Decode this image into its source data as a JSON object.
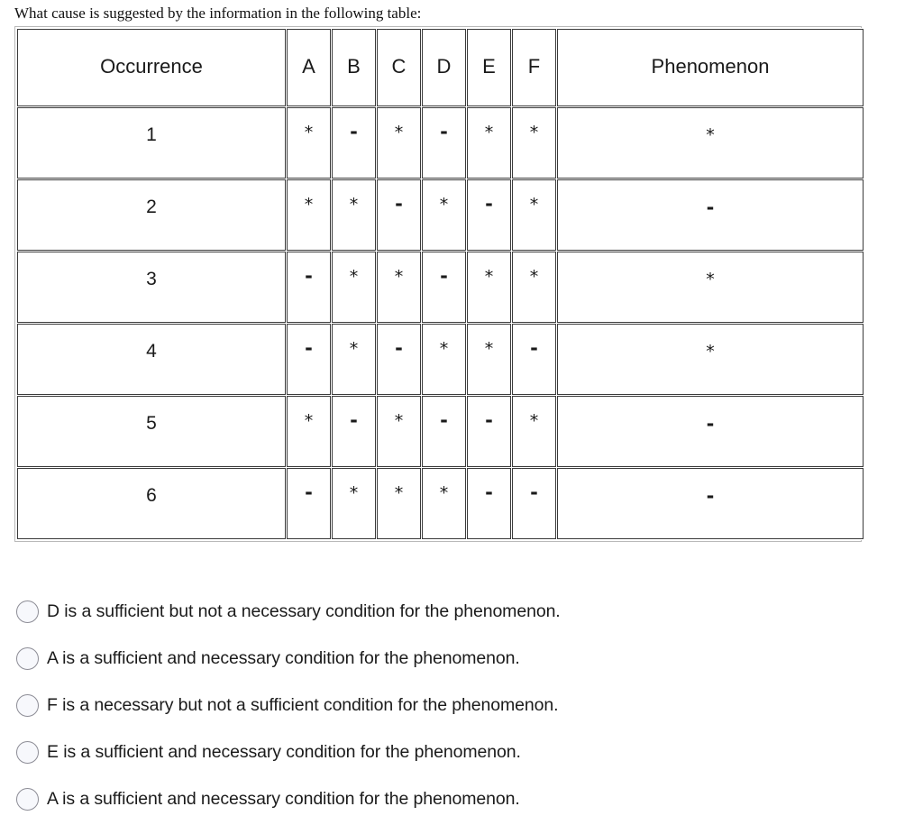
{
  "question": {
    "prompt": "What cause is suggested by the information in the following table:"
  },
  "table": {
    "headers": {
      "occurrence": "Occurrence",
      "factors": [
        "A",
        "B",
        "C",
        "D",
        "E",
        "F"
      ],
      "phenomenon": "Phenomenon"
    },
    "rows": [
      {
        "occurrence": "1",
        "factors": [
          "*",
          "-",
          "*",
          "-",
          "*",
          "*"
        ],
        "phenomenon": "*"
      },
      {
        "occurrence": "2",
        "factors": [
          "*",
          "*",
          "-",
          "*",
          "-",
          "*"
        ],
        "phenomenon": "-"
      },
      {
        "occurrence": "3",
        "factors": [
          "-",
          "*",
          "*",
          "-",
          "*",
          "*"
        ],
        "phenomenon": "*"
      },
      {
        "occurrence": "4",
        "factors": [
          "-",
          "*",
          "-",
          "*",
          "*",
          "-"
        ],
        "phenomenon": "*"
      },
      {
        "occurrence": "5",
        "factors": [
          "*",
          "-",
          "*",
          "-",
          "-",
          "*"
        ],
        "phenomenon": "-"
      },
      {
        "occurrence": "6",
        "factors": [
          "-",
          "*",
          "*",
          "*",
          "-",
          "-"
        ],
        "phenomenon": "-"
      }
    ]
  },
  "options": [
    {
      "label": "D is a sufficient but not a necessary condition for the phenomenon.",
      "selected": false
    },
    {
      "label": "A is a sufficient and necessary condition for the phenomenon.",
      "selected": false
    },
    {
      "label": "F is a necessary but not a sufficient condition for the phenomenon.",
      "selected": false
    },
    {
      "label": "E is a sufficient and necessary condition for the phenomenon.",
      "selected": false
    },
    {
      "label": "A is a sufficient and necessary condition for the phenomenon.",
      "selected": false
    }
  ]
}
